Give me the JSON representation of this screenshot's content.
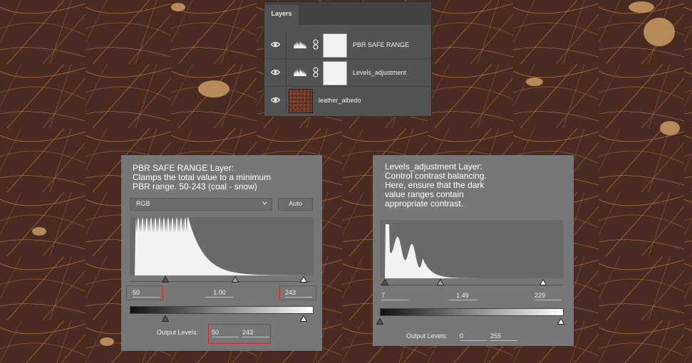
{
  "layers_panel": {
    "tab": "Layers",
    "layers": [
      {
        "name": "PBR SAFE RANGE",
        "kind": "adjustment"
      },
      {
        "name": "Levels_adjustment",
        "kind": "adjustment"
      },
      {
        "name": "leather_albedo",
        "kind": "raster"
      }
    ]
  },
  "pbr_panel": {
    "description": [
      "PBR SAFE RANGE Layer:",
      "Clamps the total value to a minimum",
      "PBR range. 50-243 (coal - snow)"
    ],
    "channel": "RGB",
    "auto_label": "Auto",
    "input_black": "50",
    "input_gamma": "1.00",
    "input_white": "243",
    "output_label": "Output Levels:",
    "output_black": "50",
    "output_white": "243"
  },
  "levels_panel": {
    "description": [
      "Levels_adjustment Layer:",
      "Control contrast balancing.",
      "Here, ensure that the dark",
      "value ranges contain",
      "appropriate contrast."
    ],
    "input_black": "7",
    "input_gamma": "1.49",
    "input_white": "229",
    "output_label": "Output Levels:",
    "output_black": "0",
    "output_white": "255"
  },
  "colors": {
    "panel": "#777777",
    "highlight": "#d9262e",
    "ui_dark": "#535353"
  },
  "icons": [
    "eye-icon",
    "levels-adjustment-icon",
    "chain-link-icon",
    "chevron-down-icon"
  ]
}
